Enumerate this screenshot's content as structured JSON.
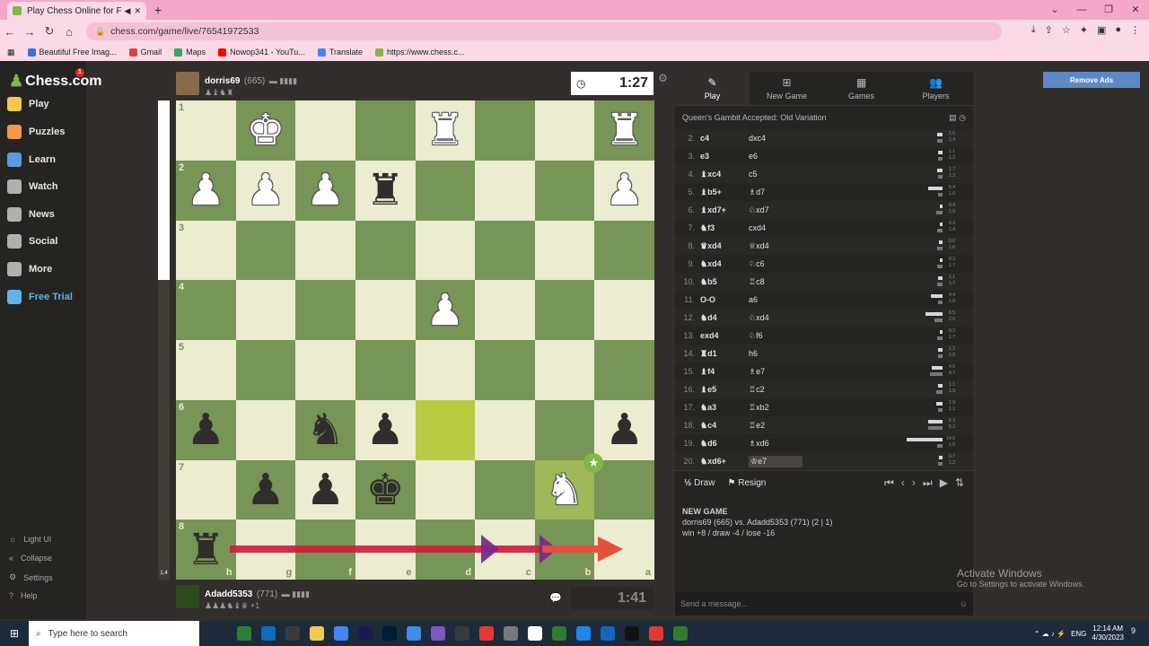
{
  "browser": {
    "tab_title": "Play Chess Online for FREE w",
    "url": "chess.com/game/live/76541972533",
    "bookmarks": [
      {
        "label": "Beautiful Free Imag...",
        "color": "#3b6fd6"
      },
      {
        "label": "Gmail",
        "color": "#d44638"
      },
      {
        "label": "Maps",
        "color": "#34a853"
      },
      {
        "label": "Nowop341 - YouTu...",
        "color": "#ff0000"
      },
      {
        "label": "Translate",
        "color": "#4285f4"
      },
      {
        "label": "https://www.chess.c...",
        "color": "#81b64c"
      }
    ]
  },
  "sidebar": {
    "logo": "Chess.com",
    "badge": "1",
    "items": [
      {
        "label": "Play",
        "color": "#f2c94c"
      },
      {
        "label": "Puzzles",
        "color": "#f2994a"
      },
      {
        "label": "Learn",
        "color": "#5c9ae0"
      },
      {
        "label": "Watch",
        "color": "#b0b0b0"
      },
      {
        "label": "News",
        "color": "#b0b0b0"
      },
      {
        "label": "Social",
        "color": "#b0b0b0"
      },
      {
        "label": "More",
        "color": "#b0b0b0"
      },
      {
        "label": "Free Trial",
        "color": "#5db6e8"
      }
    ],
    "footer": [
      {
        "label": "Light UI",
        "icon": "sun-icon"
      },
      {
        "label": "Collapse",
        "icon": "collapse-icon"
      },
      {
        "label": "Settings",
        "icon": "gear-icon"
      },
      {
        "label": "Help",
        "icon": "help-icon"
      }
    ]
  },
  "top_player": {
    "name": "dorris69",
    "rating": "(665)",
    "clock": "1:27"
  },
  "bottom_player": {
    "name": "Adadd5353",
    "rating": "(771)",
    "clock": "1:41",
    "material": "+1"
  },
  "eval": "1.4",
  "board": {
    "ranks": [
      "1",
      "2",
      "3",
      "4",
      "5",
      "6",
      "7",
      "8"
    ],
    "files": [
      "h",
      "g",
      "f",
      "e",
      "d",
      "c",
      "b",
      "a"
    ],
    "pieces": [
      {
        "sq": "g1",
        "p": "♚",
        "c": "w"
      },
      {
        "sq": "d1",
        "p": "♜",
        "c": "w"
      },
      {
        "sq": "a1",
        "p": "♜",
        "c": "w"
      },
      {
        "sq": "h2",
        "p": "♟",
        "c": "w"
      },
      {
        "sq": "g2",
        "p": "♟",
        "c": "w"
      },
      {
        "sq": "f2",
        "p": "♟",
        "c": "w"
      },
      {
        "sq": "e2",
        "p": "♜",
        "c": "b"
      },
      {
        "sq": "a2",
        "p": "♟",
        "c": "w"
      },
      {
        "sq": "d4",
        "p": "♟",
        "c": "w"
      },
      {
        "sq": "h6",
        "p": "♟",
        "c": "b"
      },
      {
        "sq": "f6",
        "p": "♞",
        "c": "b"
      },
      {
        "sq": "e6",
        "p": "♟",
        "c": "b"
      },
      {
        "sq": "a6",
        "p": "♟",
        "c": "b"
      },
      {
        "sq": "g7",
        "p": "♟",
        "c": "b"
      },
      {
        "sq": "f7",
        "p": "♟",
        "c": "b"
      },
      {
        "sq": "e7",
        "p": "♚",
        "c": "b"
      },
      {
        "sq": "b7",
        "p": "♞",
        "c": "w"
      },
      {
        "sq": "h8",
        "p": "♜",
        "c": "b"
      }
    ],
    "highlights": [
      "d6",
      "b7"
    ],
    "best_move_star": "b7"
  },
  "panel": {
    "tabs": [
      {
        "label": "Play",
        "icon": "play-icon"
      },
      {
        "label": "New Game",
        "icon": "plus-icon"
      },
      {
        "label": "Games",
        "icon": "games-icon"
      },
      {
        "label": "Players",
        "icon": "players-icon"
      }
    ],
    "opening": "Queen's Gambit Accepted: Old Variation",
    "moves": [
      {
        "n": "2.",
        "w": "c4",
        "b": "dxc4",
        "t": [
          "1.5",
          "1.4"
        ]
      },
      {
        "n": "3.",
        "w": "e3",
        "b": "e6",
        "t": [
          "1.1",
          "1.2"
        ]
      },
      {
        "n": "4.",
        "w": "♝xc4",
        "b": "c5",
        "t": [
          "1.7",
          "1.2"
        ]
      },
      {
        "n": "5.",
        "w": "♝b5+",
        "b": "♗d7",
        "t": [
          "5.4",
          "1.0"
        ]
      },
      {
        "n": "6.",
        "w": "♝xd7+",
        "b": "♘xd7",
        "t": [
          "0.4",
          "1.9"
        ]
      },
      {
        "n": "7.",
        "w": "♞f3",
        "b": "cxd4",
        "t": [
          "0.3",
          "1.4"
        ]
      },
      {
        "n": "8.",
        "w": "♛xd4",
        "b": "♕xd4",
        "t": [
          "0.6",
          "1.6"
        ]
      },
      {
        "n": "9.",
        "w": "♞xd4",
        "b": "♘c6",
        "t": [
          "0.3",
          "1.7"
        ]
      },
      {
        "n": "10.",
        "w": "♞b5",
        "b": "♖c8",
        "t": [
          "1.1",
          "1.7"
        ]
      },
      {
        "n": "11.",
        "w": "O-O",
        "b": "a6",
        "t": [
          "4.4",
          "1.0"
        ]
      },
      {
        "n": "12.",
        "w": "♞d4",
        "b": "♘xd4",
        "t": [
          "6.5",
          "2.6"
        ]
      },
      {
        "n": "13.",
        "w": "exd4",
        "b": "♘f6",
        "t": [
          "0.3",
          "1.7"
        ]
      },
      {
        "n": "14.",
        "w": "♜d1",
        "b": "h6",
        "t": [
          "1.2",
          "1.0"
        ]
      },
      {
        "n": "15.",
        "w": "♝f4",
        "b": "♗e7",
        "t": [
          "4.0",
          "4.7"
        ]
      },
      {
        "n": "16.",
        "w": "♝e5",
        "b": "♖c2",
        "t": [
          "1.1",
          "1.9"
        ]
      },
      {
        "n": "17.",
        "w": "♞a3",
        "b": "♖xb2",
        "t": [
          "1.9",
          "1.1"
        ]
      },
      {
        "n": "18.",
        "w": "♞c4",
        "b": "♖e2",
        "t": [
          "5.3",
          "5.2"
        ]
      },
      {
        "n": "19.",
        "w": "♞d6",
        "b": "♗xd6",
        "t": [
          "14.6",
          "1.5"
        ]
      },
      {
        "n": "20.",
        "w": "♞xd6+",
        "b": "♔e7",
        "t": [
          "0.7",
          "1.2"
        ]
      }
    ],
    "draw": "Draw",
    "resign": "Resign",
    "notes_title": "NEW GAME",
    "notes_line1": "dorris69 (665) vs. Adadd5353 (771) (2 | 1)",
    "notes_line2": "win +8 / draw -4 / lose -16",
    "message_placeholder": "Send a message..."
  },
  "remove_ads": "Remove Ads",
  "activate": {
    "title": "Activate Windows",
    "sub": "Go to Settings to activate Windows."
  },
  "taskbar": {
    "search": "Type here to search",
    "time": "12:14 AM",
    "date": "4/30/2023",
    "lang": "ENG",
    "notif": "9",
    "apps": [
      "#2f7d32",
      "#0f6cbd",
      "#3a3a3a",
      "#f2c94c",
      "#4285f4",
      "#1b1b4f",
      "#001e36",
      "#3d8ee6",
      "#7e57c2",
      "#3a3a3a",
      "#e53935",
      "#7a7a7a",
      "#ffffff",
      "#2e7d32",
      "#1e88e5",
      "#1565c0",
      "#111111",
      "#e53935",
      "#2e7d32"
    ]
  }
}
